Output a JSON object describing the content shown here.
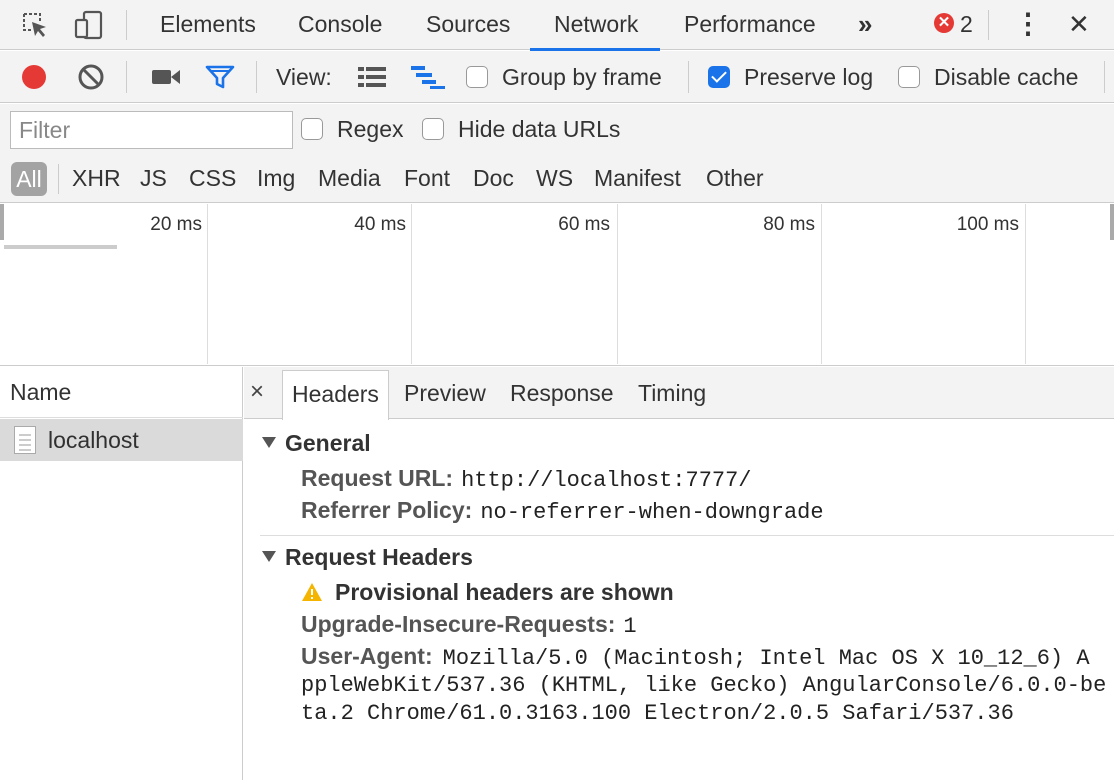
{
  "tabs": {
    "items": [
      "Elements",
      "Console",
      "Sources",
      "Network",
      "Performance"
    ],
    "active": "Network",
    "more": "»",
    "error_count": "2",
    "error_badge": "✕",
    "menu": "⋮",
    "close": "✕"
  },
  "toolbar": {
    "view_label": "View:",
    "group_by_frame": {
      "label": "Group by frame",
      "checked": false
    },
    "preserve_log": {
      "label": "Preserve log",
      "checked": true
    },
    "disable_cache": {
      "label": "Disable cache",
      "checked": false
    }
  },
  "filter": {
    "placeholder": "Filter",
    "value": "",
    "regex": {
      "label": "Regex",
      "checked": false
    },
    "hide_data_urls": {
      "label": "Hide data URLs",
      "checked": false
    }
  },
  "types": {
    "all": "All",
    "items": [
      "XHR",
      "JS",
      "CSS",
      "Img",
      "Media",
      "Font",
      "Doc",
      "WS",
      "Manifest",
      "Other"
    ]
  },
  "overview": {
    "ticks": [
      "20 ms",
      "40 ms",
      "60 ms",
      "80 ms",
      "100 ms"
    ]
  },
  "requests": {
    "header": "Name",
    "items": [
      {
        "name": "localhost"
      }
    ]
  },
  "details": {
    "close": "×",
    "tabs": [
      "Headers",
      "Preview",
      "Response",
      "Timing"
    ],
    "active_tab": "Headers",
    "general": {
      "title": "General",
      "request_url_key": "Request URL:",
      "request_url_val": "http://localhost:7777/",
      "referrer_key": "Referrer Policy:",
      "referrer_val": "no-referrer-when-downgrade"
    },
    "request_headers": {
      "title": "Request Headers",
      "warning": "Provisional headers are shown",
      "upgrade_key": "Upgrade-Insecure-Requests:",
      "upgrade_val": "1",
      "ua_key": "User-Agent:",
      "ua_line1": "Mozilla/5.0 (Macintosh; Intel Mac OS X 10_12_6) A",
      "ua_line2": "ppleWebKit/537.36 (KHTML, like Gecko) AngularConsole/6.0.0-be",
      "ua_line3": "ta.2 Chrome/61.0.3163.100 Electron/2.0.5 Safari/537.36"
    }
  },
  "colors": {
    "record": "#e53935",
    "accent": "#1a73e8",
    "error": "#e53935",
    "warning": "#f4b400"
  },
  "icons": [
    "inspect-icon",
    "device-toolbar-icon",
    "record-icon",
    "clear-icon",
    "video-camera-icon",
    "filter-icon",
    "list-view-icon",
    "waterfall-view-icon",
    "warning-icon",
    "document-icon"
  ]
}
